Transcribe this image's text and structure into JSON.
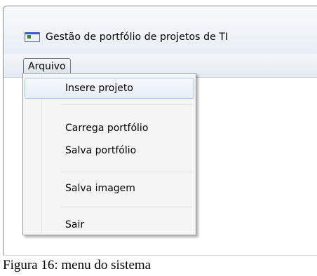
{
  "window": {
    "title": "Gestão de portfólio de projetos de TI"
  },
  "menubar": {
    "items": [
      {
        "label": "Arquivo"
      }
    ]
  },
  "dropdown": {
    "items": [
      {
        "label": "Insere projeto"
      },
      {
        "label": "Carrega portfólio"
      },
      {
        "label": "Salva portfólio"
      },
      {
        "label": "Salva imagem"
      },
      {
        "label": "Sair"
      }
    ]
  },
  "caption": {
    "text": "Figura 16: menu do sistema"
  }
}
